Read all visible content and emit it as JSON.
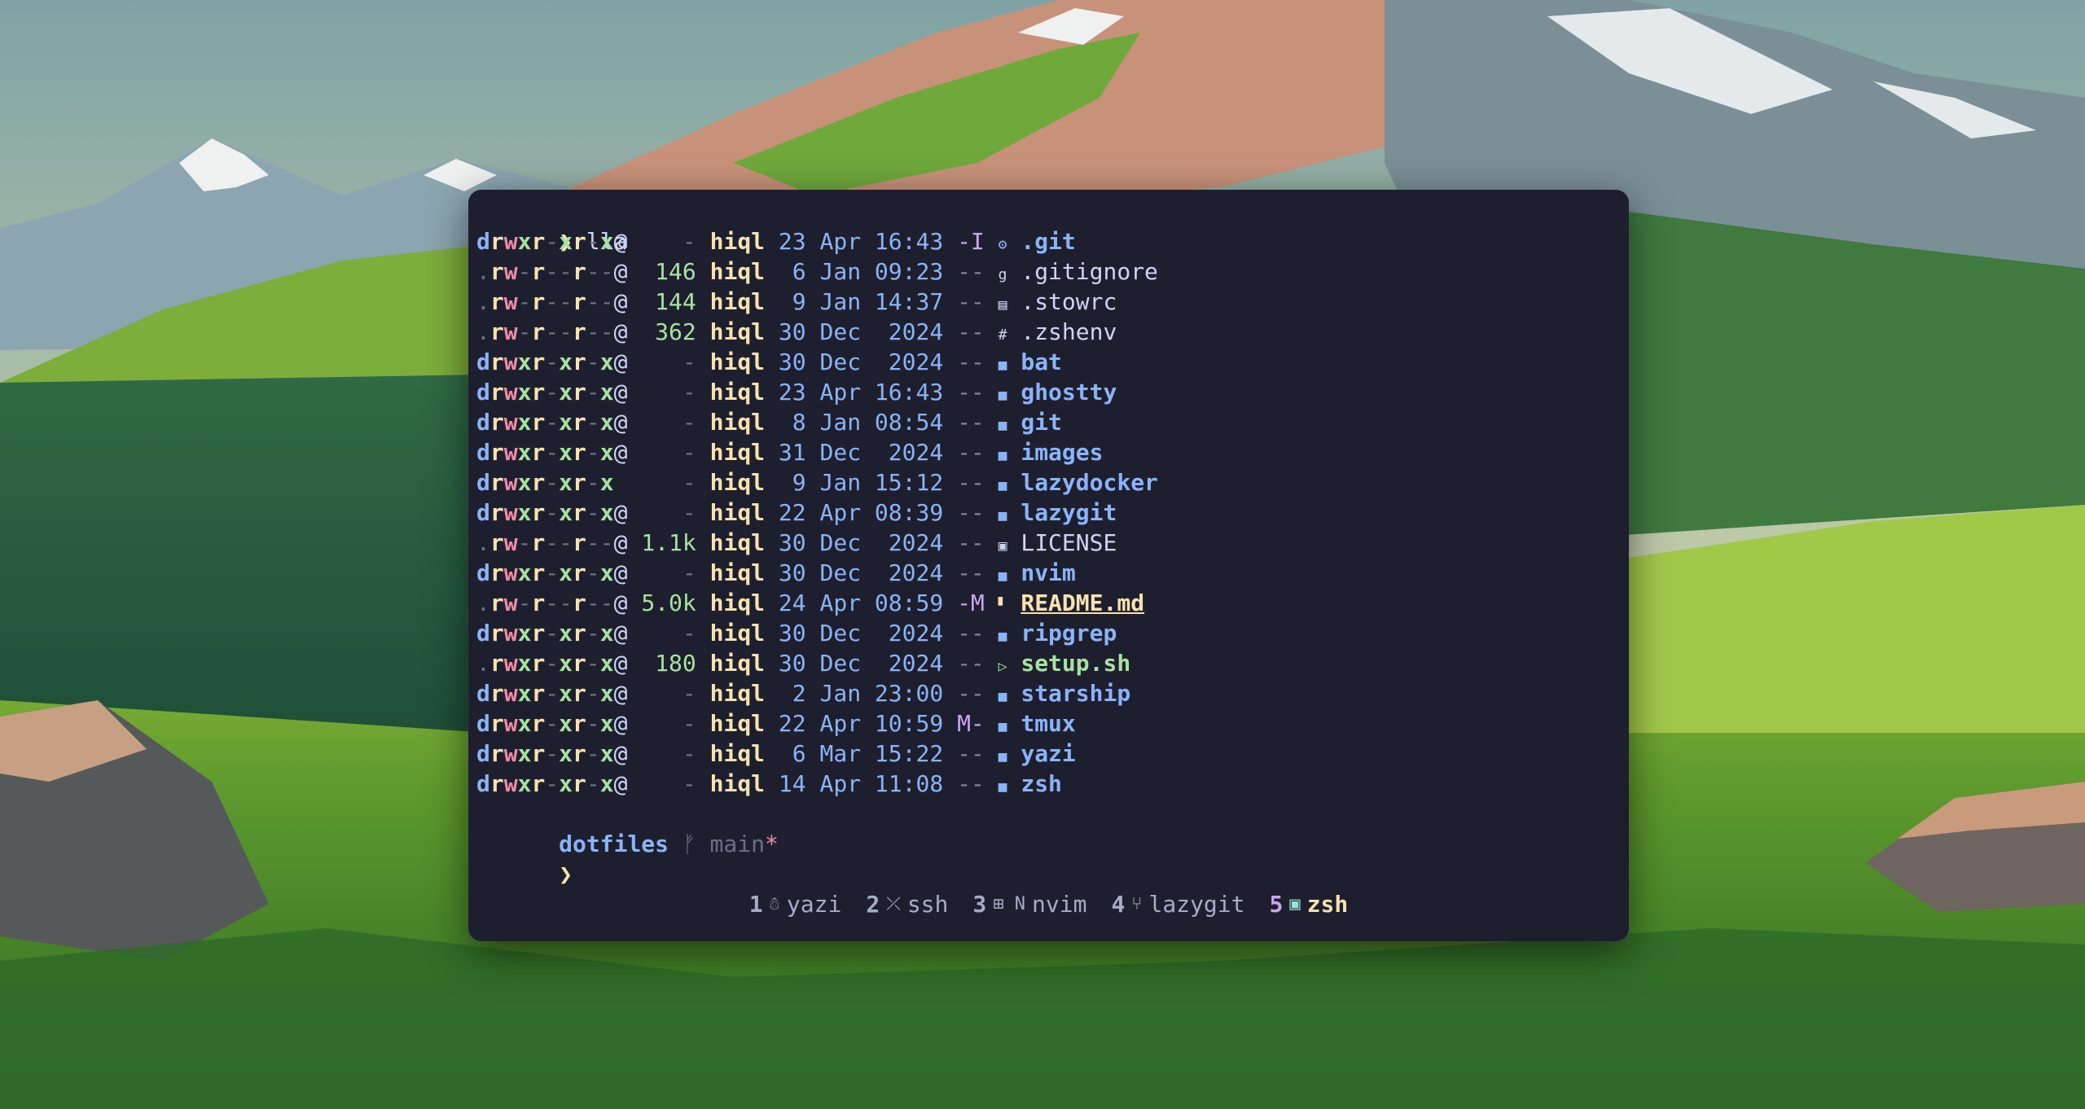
{
  "command": {
    "prompt": "❯",
    "text": "lla"
  },
  "listing": [
    {
      "perms": "drwxr-xr-x@",
      "size": "-",
      "user": "hiql",
      "date": "23 Apr 16:43",
      "git": "-I",
      "icon": "git-folder-icon",
      "glyph": "⚙",
      "name": ".git",
      "kind": "dir"
    },
    {
      "perms": ".rw-r--r--@",
      "size": "146",
      "user": "hiql",
      "date": " 6 Jan 09:23",
      "git": "--",
      "icon": "git-icon",
      "glyph": "g",
      "name": ".gitignore",
      "kind": "file"
    },
    {
      "perms": ".rw-r--r--@",
      "size": "144",
      "user": "hiql",
      "date": " 9 Jan 14:37",
      "git": "--",
      "icon": "file-icon",
      "glyph": "▤",
      "name": ".stowrc",
      "kind": "file"
    },
    {
      "perms": ".rw-r--r--@",
      "size": "362",
      "user": "hiql",
      "date": "30 Dec  2024",
      "git": "--",
      "icon": "shell-config-icon",
      "glyph": "#",
      "name": ".zshenv",
      "kind": "file"
    },
    {
      "perms": "drwxr-xr-x@",
      "size": "-",
      "user": "hiql",
      "date": "30 Dec  2024",
      "git": "--",
      "icon": "folder-icon",
      "glyph": "■",
      "name": "bat",
      "kind": "dir"
    },
    {
      "perms": "drwxr-xr-x@",
      "size": "-",
      "user": "hiql",
      "date": "23 Apr 16:43",
      "git": "--",
      "icon": "folder-icon",
      "glyph": "■",
      "name": "ghostty",
      "kind": "dir"
    },
    {
      "perms": "drwxr-xr-x@",
      "size": "-",
      "user": "hiql",
      "date": " 8 Jan 08:54",
      "git": "--",
      "icon": "folder-icon",
      "glyph": "■",
      "name": "git",
      "kind": "dir"
    },
    {
      "perms": "drwxr-xr-x@",
      "size": "-",
      "user": "hiql",
      "date": "31 Dec  2024",
      "git": "--",
      "icon": "folder-icon",
      "glyph": "■",
      "name": "images",
      "kind": "dir"
    },
    {
      "perms": "drwxr-xr-x",
      "size": "-",
      "user": "hiql",
      "date": " 9 Jan 15:12",
      "git": "--",
      "icon": "folder-icon",
      "glyph": "■",
      "name": "lazydocker",
      "kind": "dir"
    },
    {
      "perms": "drwxr-xr-x@",
      "size": "-",
      "user": "hiql",
      "date": "22 Apr 08:39",
      "git": "--",
      "icon": "folder-icon",
      "glyph": "■",
      "name": "lazygit",
      "kind": "dir"
    },
    {
      "perms": ".rw-r--r--@",
      "size": "1.1k",
      "user": "hiql",
      "date": "30 Dec  2024",
      "git": "--",
      "icon": "license-icon",
      "glyph": "▣",
      "name": "LICENSE",
      "kind": "file"
    },
    {
      "perms": "drwxr-xr-x@",
      "size": "-",
      "user": "hiql",
      "date": "30 Dec  2024",
      "git": "--",
      "icon": "folder-icon",
      "glyph": "■",
      "name": "nvim",
      "kind": "dir"
    },
    {
      "perms": ".rw-r--r--@",
      "size": "5.0k",
      "user": "hiql",
      "date": "24 Apr 08:59",
      "git": "-M",
      "icon": "markdown-icon",
      "glyph": "▘",
      "name": "README.md",
      "kind": "readme"
    },
    {
      "perms": "drwxr-xr-x@",
      "size": "-",
      "user": "hiql",
      "date": "30 Dec  2024",
      "git": "--",
      "icon": "folder-icon",
      "glyph": "■",
      "name": "ripgrep",
      "kind": "dir"
    },
    {
      "perms": ".rwxr-xr-x@",
      "size": "180",
      "user": "hiql",
      "date": "30 Dec  2024",
      "git": "--",
      "icon": "terminal-script-icon",
      "glyph": "▷",
      "name": "setup.sh",
      "kind": "exec"
    },
    {
      "perms": "drwxr-xr-x@",
      "size": "-",
      "user": "hiql",
      "date": " 2 Jan 23:00",
      "git": "--",
      "icon": "folder-icon",
      "glyph": "■",
      "name": "starship",
      "kind": "dir"
    },
    {
      "perms": "drwxr-xr-x@",
      "size": "-",
      "user": "hiql",
      "date": "22 Apr 10:59",
      "git": "M-",
      "icon": "folder-icon",
      "glyph": "■",
      "name": "tmux",
      "kind": "dir"
    },
    {
      "perms": "drwxr-xr-x@",
      "size": "-",
      "user": "hiql",
      "date": " 6 Mar 15:22",
      "git": "--",
      "icon": "folder-icon",
      "glyph": "■",
      "name": "yazi",
      "kind": "dir"
    },
    {
      "perms": "drwxr-xr-x@",
      "size": "-",
      "user": "hiql",
      "date": "14 Apr 11:08",
      "git": "--",
      "icon": "folder-icon",
      "glyph": "■",
      "name": "zsh",
      "kind": "dir"
    }
  ],
  "prompt": {
    "directory": "dotfiles",
    "branch_icon": "git-branch-icon",
    "branch_glyph": "ᚠ",
    "branch": "main",
    "dirty_marker": "*",
    "symbol": "❯"
  },
  "tmux": {
    "windows": [
      {
        "index": "1",
        "icon": "yazi-duck-icon",
        "glyph": "☃",
        "name": "yazi",
        "active": false
      },
      {
        "index": "2",
        "icon": "ssh-icon",
        "glyph": "⤫",
        "name": "ssh",
        "active": false
      },
      {
        "index": "3",
        "icon": "nvim-icon",
        "glyph": "⊞ N",
        "name": "nvim",
        "active": false
      },
      {
        "index": "4",
        "icon": "git-branch-icon",
        "glyph": "⑂",
        "name": "lazygit",
        "active": false
      },
      {
        "index": "5",
        "icon": "terminal-icon",
        "glyph": "▣",
        "name": "zsh",
        "active": true
      }
    ]
  }
}
